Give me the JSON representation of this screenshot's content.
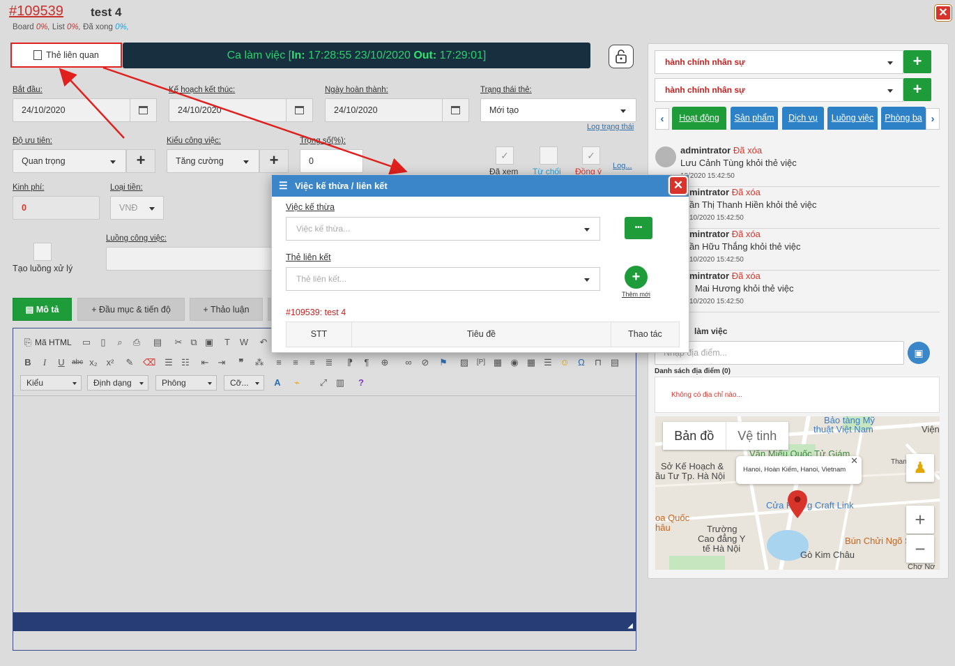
{
  "header": {
    "card_id": "#109539",
    "card_title": "test 4",
    "progress": {
      "board_label": "Board",
      "board_value": "0%,",
      "list_label": "List",
      "list_value": "0%,",
      "done_label": "Đã xong",
      "done_value": "0%,"
    },
    "close_label": "✕"
  },
  "toolbar": {
    "related_button": "Thẻ liên quan",
    "shift_prefix": "Ca làm việc [",
    "shift_in_label": "In:",
    "shift_in_value": " 17:28:55 23/10/2020 ",
    "shift_out_label": "Out:",
    "shift_out_value": " 17:29:01]"
  },
  "form": {
    "start_label": "Bắt đầu:",
    "start_value": "24/10/2020",
    "plan_end_label": "Kế hoạch kết thúc:",
    "plan_end_value": "24/10/2020",
    "done_date_label": "Ngày hoàn thành:",
    "done_date_value": "24/10/2020",
    "status_label": "Trạng thái thẻ:",
    "status_value": "Mới tạo",
    "status_log": "Log trạng thái",
    "priority_label": "Độ ưu tiên:",
    "priority_value": "Quan trọng",
    "work_type_label": "Kiểu công việc:",
    "work_type_value": "Tăng cường",
    "weight_label": "Trọng số(%):",
    "weight_value": "0",
    "checks": [
      "Đã xem",
      "Từ chối",
      "Đồng ý"
    ],
    "log_link": "Log...",
    "cost_label": "Kinh phí:",
    "cost_value": "0",
    "currency_label": "Loại tiền:",
    "currency_value": "VNĐ",
    "flow_create_label": "Tạo luồng xử lý",
    "flow_label": "Luồng công việc:",
    "plus": "+"
  },
  "tabs": {
    "description": "Mô tả",
    "milestones": "Đầu mục & tiến độ",
    "discussion": "Thảo luận"
  },
  "editor": {
    "html_label": "Mã HTML",
    "style_select": "Kiểu",
    "format_select": "Định dạng",
    "font_select": "Phông",
    "size_select": "Cỡ..."
  },
  "right": {
    "select1": "hành chính nhân sự",
    "select2": "hành chính nhân sự",
    "tabs": [
      "Hoạt động",
      "Sản phẩm",
      "Dịch vụ",
      "Luồng việc",
      "Phòng ba"
    ],
    "activities": [
      {
        "who": "admintrator",
        "action": "Đã xóa",
        "msg": "Lưu Cảnh Tùng khỏi thẻ việc",
        "time": "10/2020 15:42:50"
      },
      {
        "who": "mintrator",
        "action": "Đã xóa",
        "msg": "ần Thị Thanh Hiền khỏi thẻ việc",
        "time": "10/2020 15:42:50"
      },
      {
        "who": "mintrator",
        "action": "Đã xóa",
        "msg": "ần Hữu Thắng khỏi thẻ việc",
        "time": "10/2020 15:42:50"
      },
      {
        "who": "mintrator",
        "action": "Đã xóa",
        "msg": "Mai Hương khỏi thẻ việc",
        "time": "10/2020 15:42:50"
      }
    ],
    "location_title": "làm việc",
    "location_placeholder": "Nhập địa điểm...",
    "location_list_title": "Danh sách địa điểm (0)",
    "location_empty": "Không có địa chỉ nào..."
  },
  "map": {
    "tab_map": "Bản đồ",
    "tab_satellite": "Vệ tinh",
    "info": "Hanoi, Hoàn Kiếm, Hanoi, Vietnam",
    "labels": {
      "museum": "Bảo tàng Mỹ",
      "museum2": "thuật Việt Nam",
      "vien": "Viện",
      "temple": "Văn Miếu Quốc Tử Giám",
      "dept": "Sở Kế Hoạch &",
      "dept2": "ầu Tư Tp. Hà Nội",
      "thanh": "Thanh M",
      "khoa": "oa Quốc",
      "khoa2": "hâu",
      "cua": "Cửa H",
      "craft": "g Craft Link",
      "truong": "Trường",
      "truong2": "Cao đẳng Y",
      "truong3": "tế Hà Nội",
      "bun": "Bún Chửi Ngõ Sĩ Liên",
      "go": "Gò Kim Châu",
      "cho": "Chợ Nơ"
    },
    "zoom_in": "+",
    "zoom_out": "−"
  },
  "modal": {
    "title": "Việc kế thừa / liên kết",
    "inherit_label": "Việc kế thừa",
    "inherit_placeholder": "Việc kế thừa...",
    "link_label": "Thẻ liên kết",
    "link_placeholder": "Thẻ liên kết...",
    "new_label": "Thêm mới",
    "card_ref": "#109539: test 4",
    "columns": [
      "STT",
      "Tiêu đề",
      "Thao tác"
    ],
    "close": "✕",
    "more": "•••"
  },
  "colors": {
    "accent_green": "#1f9c3a",
    "accent_blue": "#3a86c8",
    "danger": "#d9342b",
    "shift_bar": "#172f3f"
  }
}
